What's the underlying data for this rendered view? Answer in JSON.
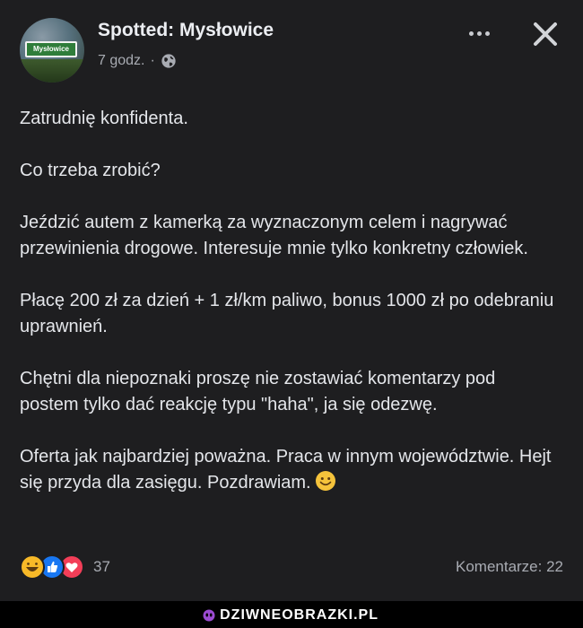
{
  "post": {
    "page_name": "Spotted: Mysłowice",
    "avatar_sign_text": "Mysłowice",
    "time": "7 godz.",
    "separator": "·",
    "privacy_icon": "globe-icon",
    "paragraphs": [
      "Zatrudnię konfidenta.",
      "Co trzeba zrobić?",
      "Jeździć autem z kamerką za wyznaczonym celem i nagrywać przewinienia drogowe. Interesuje mnie tylko konkretny człowiek.",
      "Płacę 200 zł za dzień + 1 zł/km paliwo, bonus 1000 zł po odebraniu uprawnień.",
      "Chętni dla niepoznaki proszę nie zostawiać komentarzy pod postem tylko dać reakcję typu \"haha\", ja się odezwę.",
      "Oferta jak najbardziej poważna. Praca w innym województwie. Hejt się przyda dla zasięgu. Pozdrawiam."
    ],
    "reactions": {
      "icons": [
        "haha-reaction-icon",
        "like-reaction-icon",
        "love-reaction-icon"
      ],
      "count": "37"
    },
    "comments_label": "Komentarze: 22"
  },
  "colors": {
    "background": "#1e1e20",
    "text": "#e4e6ea",
    "secondary_text": "#a8abb2",
    "like_blue": "#1877f2",
    "love_red": "#f33e58",
    "haha_yellow": "#f7b928"
  },
  "watermark": {
    "text": "DZIWNEOBRAZKI.PL"
  }
}
